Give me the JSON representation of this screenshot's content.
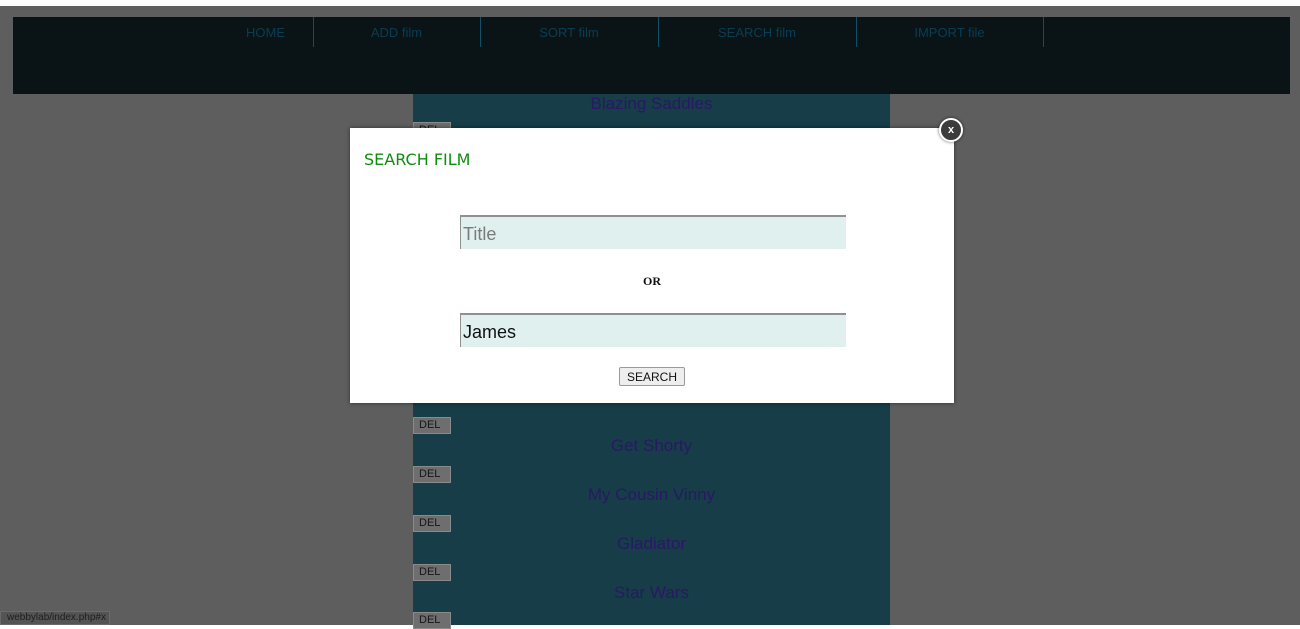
{
  "nav": {
    "items": [
      {
        "label": "HOME"
      },
      {
        "label": "ADD film"
      },
      {
        "label": "SORT film"
      },
      {
        "label": "SEARCH film"
      },
      {
        "label": "IMPORT file"
      }
    ]
  },
  "films": [
    {
      "title": "Blazing Saddles"
    },
    {
      "title": "Get Shorty"
    },
    {
      "title": "My Cousin Vinny"
    },
    {
      "title": "Gladiator"
    },
    {
      "title": "Star Wars"
    }
  ],
  "del_label": "DEL",
  "modal": {
    "title": "SEARCH FILM",
    "title_placeholder": "Title",
    "title_value": "",
    "or_label": "OR",
    "star_value": "James",
    "search_label": "SEARCH",
    "close_label": "x"
  },
  "status_bar": {
    "url": "webbylab/index.php#x"
  },
  "colors": {
    "overlay": "#5e5e5e",
    "navbar": "#0a1417",
    "film_column": "#163d48",
    "modal_title": "#108d10",
    "input_bg": "#dff0ef"
  }
}
